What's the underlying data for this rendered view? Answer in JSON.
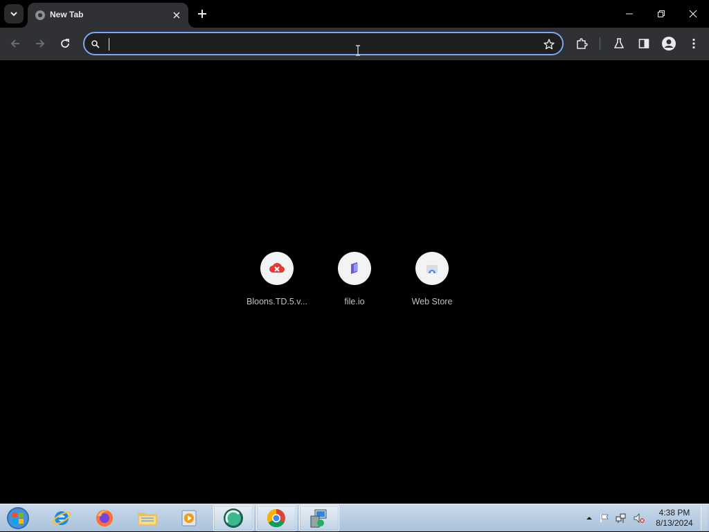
{
  "window": {
    "tab_title": "New Tab",
    "tab_favicon": "globe-icon",
    "buttons": {
      "minimize": "minimize-icon",
      "maximize": "restore-icon",
      "close": "close-icon"
    }
  },
  "toolbar": {
    "back": "back-arrow-icon",
    "forward": "forward-arrow-icon",
    "reload": "reload-icon",
    "omnibox": {
      "value": "",
      "placeholder": ""
    },
    "right_icons": [
      "extensions-icon",
      "labs-flask-icon",
      "side-panel-icon",
      "profile-avatar-icon",
      "kebab-menu-icon"
    ]
  },
  "shortcuts": [
    {
      "label": "Bloons.TD.5.v...",
      "icon": "mega-cloud-icon",
      "color": "#e53935"
    },
    {
      "label": "file.io",
      "icon": "file-io-icon",
      "color": "#6a5acd"
    },
    {
      "label": "Web Store",
      "icon": "web-store-icon",
      "color": "#4285f4"
    }
  ],
  "taskbar": {
    "apps": [
      "start-orb-icon",
      "internet-explorer-icon",
      "firefox-icon",
      "file-explorer-icon",
      "media-player-icon",
      "app-icon",
      "chrome-icon",
      "network-setup-icon"
    ],
    "tray": [
      "show-hidden-icons-icon",
      "action-center-flag-icon",
      "network-icon",
      "volume-muted-icon"
    ],
    "clock_time": "4:38 PM",
    "clock_date": "8/13/2024"
  },
  "colors": {
    "accent": "#7aa7f7",
    "background": "#000000",
    "toolbar": "#303134"
  }
}
